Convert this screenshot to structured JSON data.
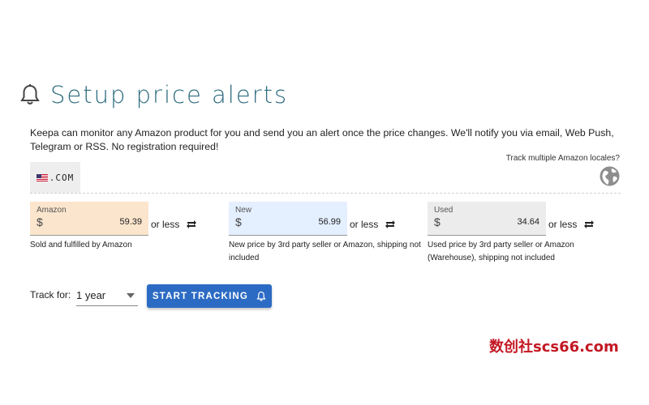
{
  "header": {
    "title": "Setup price alerts",
    "icon": "bell-icon"
  },
  "intro": {
    "text": "Keepa can monitor any Amazon product for you and send you an alert once the price changes. We'll notify you via email, Web Push, Telegram or RSS. No registration required!"
  },
  "locales": {
    "link_text": "Track multiple Amazon locales?",
    "icon": "globe-icon"
  },
  "domain": {
    "label": ".COM",
    "icon": "us-flag-icon"
  },
  "fields": [
    {
      "label": "Amazon",
      "currency": "$",
      "value": "59.39",
      "suffix": "or less",
      "description": "Sold and fulfilled by Amazon",
      "color": "#fbe5cd"
    },
    {
      "label": "New",
      "currency": "$",
      "value": "56.99",
      "suffix": "or less",
      "description": "New price by 3rd party seller or Amazon, shipping not included",
      "color": "#e4efff"
    },
    {
      "label": "Used",
      "currency": "$",
      "value": "34.64",
      "suffix": "or less",
      "description": "Used price by 3rd party seller or Amazon (Warehouse), shipping not included",
      "color": "#ececec"
    }
  ],
  "tracking": {
    "label": "Track for:",
    "duration": "1 year",
    "button_label": "START TRACKING"
  },
  "watermark": "数创社scs66.com",
  "colors": {
    "title": "#2c6b7f",
    "button": "#2b6bc4",
    "watermark": "#c31924"
  }
}
